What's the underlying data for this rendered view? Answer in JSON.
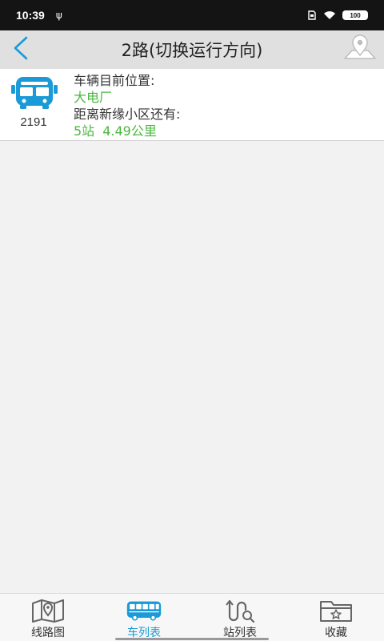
{
  "status_bar": {
    "time": "10:39",
    "usb_symbol": "ψ",
    "battery_text": "100"
  },
  "header": {
    "title": "2路(切换运行方向)",
    "back_icon": "chevron-left-icon",
    "map_icon": "map-pin-icon"
  },
  "vehicle": {
    "bus_number": "2191",
    "position_label": "车辆目前位置:",
    "position_value": "大电厂",
    "distance_label": "距离新缘小区还有:",
    "stops": "5站",
    "distance_km": "4.49公里"
  },
  "bottom_nav": {
    "items": [
      {
        "label": "线路图",
        "icon": "route-map-icon"
      },
      {
        "label": "车列表",
        "icon": "bus-icon",
        "active": true
      },
      {
        "label": "站列表",
        "icon": "station-search-icon"
      },
      {
        "label": "收藏",
        "icon": "favorite-folder-icon"
      }
    ]
  },
  "colors": {
    "accent": "#1a9ad6",
    "value_green": "#49b83e",
    "header_bg": "#e0e0e0"
  }
}
